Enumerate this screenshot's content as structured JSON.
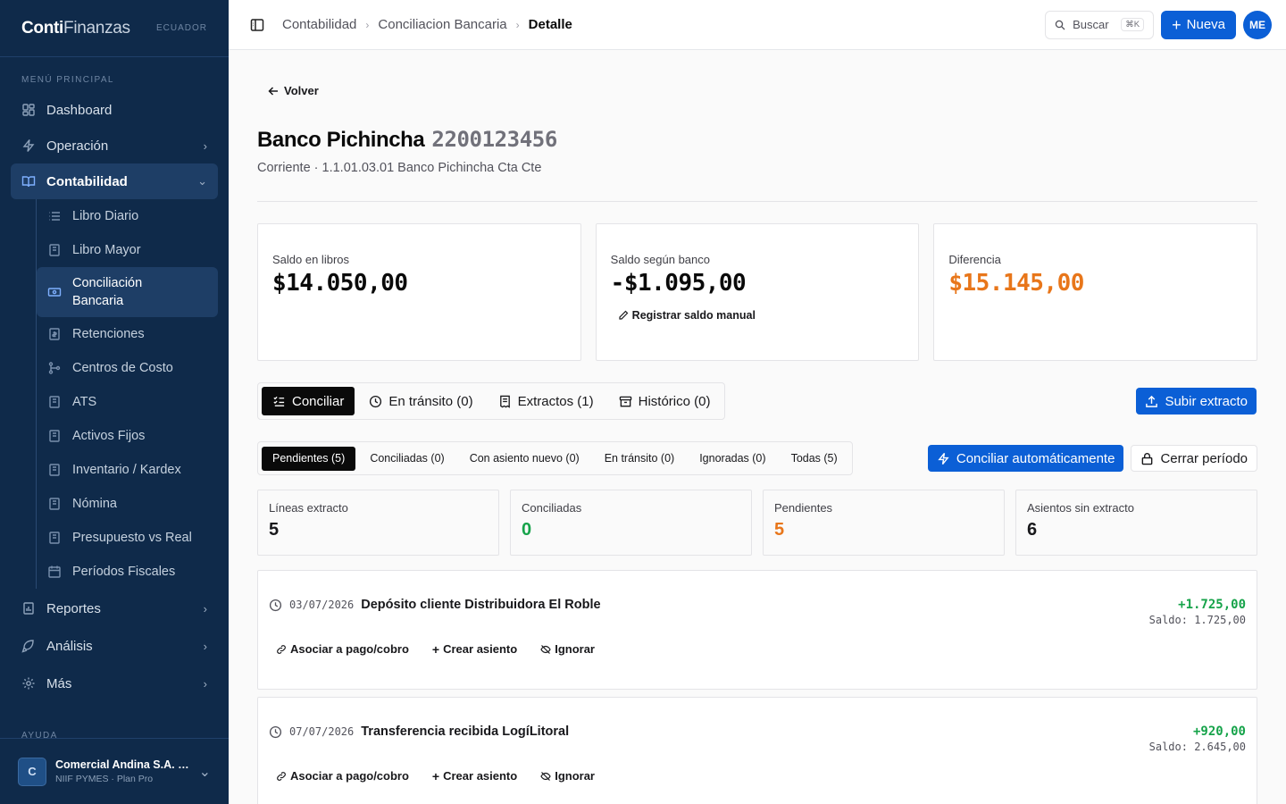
{
  "brand": {
    "name_bold": "Conti",
    "name_light": "Finanzas",
    "region": "ECUADOR"
  },
  "sidebar": {
    "section": "MENÚ PRINCIPAL",
    "items": [
      {
        "label": "Dashboard",
        "icon": "dashboard-icon"
      },
      {
        "label": "Operación",
        "icon": "bolt-icon"
      },
      {
        "label": "Contabilidad",
        "icon": "book-icon"
      }
    ],
    "sub_items": [
      {
        "label": "Libro Diario"
      },
      {
        "label": "Libro Mayor"
      },
      {
        "label": "Conciliación Bancaria"
      },
      {
        "label": "Retenciones"
      },
      {
        "label": "Centros de Costo"
      },
      {
        "label": "ATS"
      },
      {
        "label": "Activos Fijos"
      },
      {
        "label": "Inventario / Kardex"
      },
      {
        "label": "Nómina"
      },
      {
        "label": "Presupuesto vs Real"
      },
      {
        "label": "Períodos Fiscales"
      }
    ],
    "after_items": [
      {
        "label": "Reportes"
      },
      {
        "label": "Análisis"
      },
      {
        "label": "Más"
      }
    ],
    "help_label": "AYUDA",
    "org": {
      "initial": "C",
      "name": "Comercial Andina S.A. (Demo)",
      "plan": "NIIF PYMES · Plan Pro"
    }
  },
  "topbar": {
    "breadcrumb": [
      "Contabilidad",
      "Conciliacion Bancaria",
      "Detalle"
    ],
    "search_label": "Buscar",
    "search_kbd": "⌘K",
    "new_label": "Nueva",
    "user_initials": "ME"
  },
  "page": {
    "back_label": "Volver",
    "bank_name": "Banco Pichincha",
    "account_number": "2200123456",
    "subtitle": "Corriente · 1.1.01.03.01 Banco Pichincha Cta Cte"
  },
  "cards": {
    "books": {
      "label": "Saldo en libros",
      "value": "$14.050,00"
    },
    "bank": {
      "label": "Saldo según banco",
      "value": "-$1.095,00",
      "action": "Registrar saldo manual"
    },
    "diff": {
      "label": "Diferencia",
      "value": "$15.145,00"
    }
  },
  "tabs": [
    {
      "label": "Conciliar"
    },
    {
      "label": "En tránsito (0)"
    },
    {
      "label": "Extractos (1)"
    },
    {
      "label": "Histórico (0)"
    }
  ],
  "upload_label": "Subir extracto",
  "filters": [
    {
      "label": "Pendientes (5)"
    },
    {
      "label": "Conciliadas (0)"
    },
    {
      "label": "Con asiento nuevo (0)"
    },
    {
      "label": "En tránsito (0)"
    },
    {
      "label": "Ignoradas (0)"
    },
    {
      "label": "Todas (5)"
    }
  ],
  "auto_label": "Conciliar automáticamente",
  "close_label": "Cerrar período",
  "stats": [
    {
      "label": "Líneas extracto",
      "value": "5"
    },
    {
      "label": "Conciliadas",
      "value": "0"
    },
    {
      "label": "Pendientes",
      "value": "5"
    },
    {
      "label": "Asientos sin extracto",
      "value": "6"
    }
  ],
  "lines": [
    {
      "date": "03/07/2026",
      "description": "Depósito cliente Distribuidora El Roble",
      "amount": "+1.725,00",
      "balance": "Saldo: 1.725,00"
    },
    {
      "date": "07/07/2026",
      "description": "Transferencia recibida LogíLitoral",
      "amount": "+920,00",
      "balance": "Saldo: 2.645,00"
    }
  ],
  "line_actions": {
    "associate": "Asociar a pago/cobro",
    "create": "Crear asiento",
    "ignore": "Ignorar"
  },
  "colors": {
    "sidebar": "#0f2a4a",
    "primary": "#0b5fd6",
    "positive": "#16a34a",
    "warning": "#e8761a"
  }
}
